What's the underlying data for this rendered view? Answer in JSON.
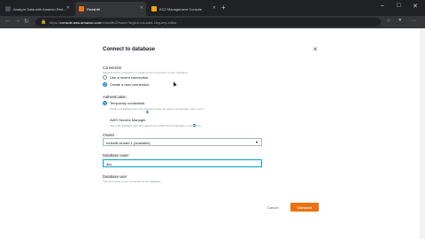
{
  "browser": {
    "tabs": [
      {
        "label": "Analyze Data with Amazon Red...",
        "favicon_color": "#4a4f55"
      },
      {
        "label": "Redshift",
        "favicon_color": "#ec7211"
      },
      {
        "label": "EC2 Management Console",
        "favicon_color": "#f0a30a"
      }
    ],
    "new_tab": "+",
    "address": {
      "scheme": "https://",
      "host": "console.aws.amazon.com",
      "path": "/redshiftv2/home?region=us-east-1#query-editor"
    },
    "window_controls": [
      "–",
      "□",
      "✕"
    ]
  },
  "modal": {
    "title": "Connect to database",
    "close": "✕",
    "connection": {
      "label": "Connection",
      "description": "Select a recent connection or create a new connection to your database.",
      "options": [
        {
          "label": "Use a recent connection",
          "selected": false
        },
        {
          "label": "Create a new connection",
          "selected": true
        }
      ]
    },
    "authentication": {
      "label": "Authentication",
      "options": [
        {
          "label": "Temporary credentials",
          "description": "Create a database user and password using temporary credentials. Learn more",
          "selected": true
        },
        {
          "label": "AWS Secrets Manager",
          "description": "Store the database user and password in AWS Secrets Manager. Learn more",
          "selected": false
        }
      ]
    },
    "cluster": {
      "label": "Cluster",
      "value": "redshift-cluster-1 (Available)"
    },
    "database_name": {
      "label": "Database name",
      "value": "dev"
    },
    "database_user": {
      "label": "Database user",
      "description": "The user name to use to connect to the database."
    },
    "cancel_label": "Cancel",
    "connect_label": "Connect"
  },
  "colors": {
    "accent": "#0073bb",
    "primary_button": "#ec7211",
    "focus": "#00a1c9"
  }
}
